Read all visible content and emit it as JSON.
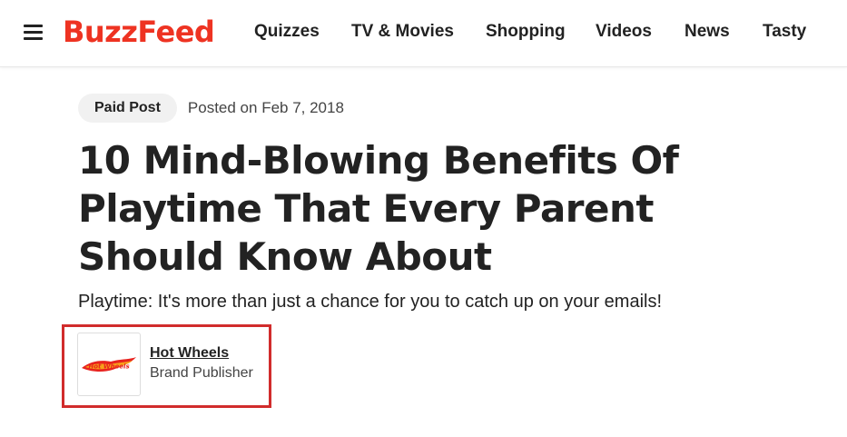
{
  "header": {
    "logo": "BuzzFeed",
    "nav": [
      "Quizzes",
      "TV & Movies",
      "Shopping",
      "Videos",
      "News",
      "Tasty"
    ]
  },
  "article": {
    "badge": "Paid Post",
    "posted": "Posted on Feb 7, 2018",
    "title": "10 Mind-Blowing Benefits Of Playtime That Every Parent Should Know About",
    "subtitle": "Playtime: It's more than just a chance for you to catch up on your emails!"
  },
  "publisher": {
    "logo_text": "Hot Wheels",
    "name": "Hot Wheels",
    "role": "Brand Publisher"
  },
  "colors": {
    "brand": "#ee3322",
    "highlight": "#d12c2c",
    "text": "#222222",
    "badge_bg": "#f1f1f1"
  }
}
